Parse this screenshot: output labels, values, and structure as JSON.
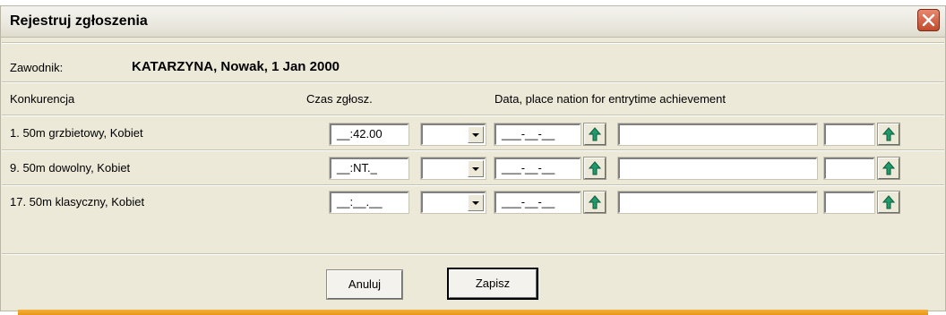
{
  "window": {
    "title": "Rejestruj zgłoszenia",
    "close_icon": "close-icon"
  },
  "athlete": {
    "label": "Zawodnik:",
    "value": "KATARZYNA, Nowak, 1 Jan 2000"
  },
  "columns": {
    "event": "Konkurencja",
    "time": "Czas zgłosz.",
    "data": "Data, place nation for entrytime achievement"
  },
  "rows": [
    {
      "event": "1. 50m grzbietowy, Kobiet",
      "time": "__:42.00",
      "select": "",
      "date": "___-__-__",
      "place": "",
      "nation": ""
    },
    {
      "event": "9. 50m dowolny, Kobiet",
      "time": "__:NT._",
      "select": "",
      "date": "___-__-__",
      "place": "",
      "nation": ""
    },
    {
      "event": "17. 50m klasyczny, Kobiet",
      "time": "__:__.__",
      "select": "",
      "date": "___-__-__",
      "place": "",
      "nation": ""
    }
  ],
  "buttons": {
    "cancel": "Anuluj",
    "save": "Zapisz"
  },
  "colors": {
    "dialog_bg": "#ece9d8",
    "close_red": "#c24a2c",
    "arrow_green": "#1f9a6a",
    "accent_orange": "#e89618"
  }
}
